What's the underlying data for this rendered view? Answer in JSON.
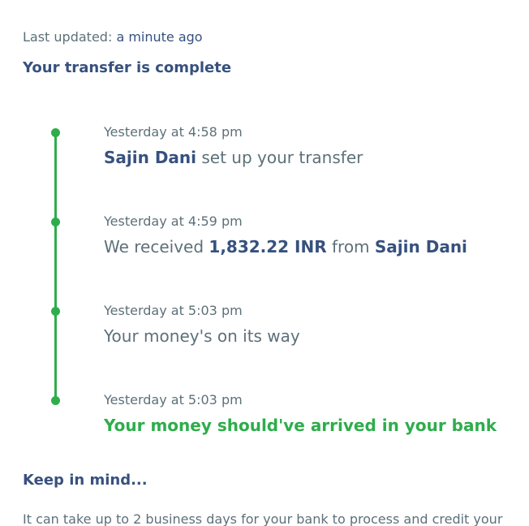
{
  "last_updated": {
    "label": "Last updated:",
    "value": "a minute ago"
  },
  "status_title": "Your transfer is complete",
  "timeline": {
    "events": [
      {
        "time": "Yesterday at 4:58 pm",
        "name": "Sajin Dani",
        "text": "set up your transfer"
      },
      {
        "time": "Yesterday at 4:59 pm",
        "prefix": "We received",
        "amount": "1,832.22 INR",
        "from_label": "from",
        "name": "Sajin Dani"
      },
      {
        "time": "Yesterday at 5:03 pm",
        "text": "Your money's on its way"
      },
      {
        "time": "Yesterday at 5:03 pm",
        "text": "Your money should've arrived in your bank"
      }
    ]
  },
  "keep_in_mind": {
    "title": "Keep in mind...",
    "body": "It can take up to 2 business days for your bank to process and credit your"
  },
  "colors": {
    "timeline": "#2ead4b",
    "heading": "#37517e",
    "body_text": "#5d7079"
  }
}
